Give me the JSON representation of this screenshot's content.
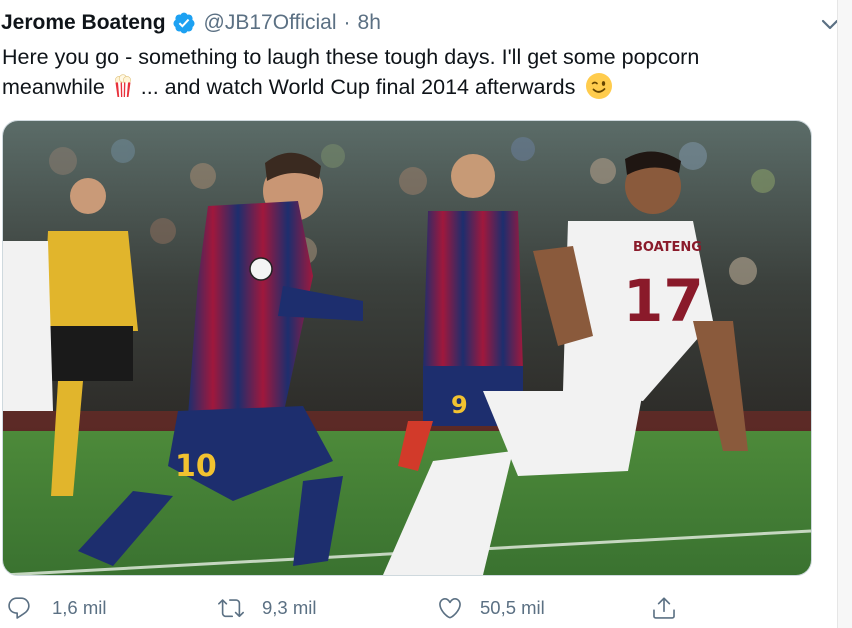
{
  "tweet": {
    "author": {
      "name": "Jerome Boateng",
      "handle": "@JB17Official",
      "separator": "·",
      "time": "8h",
      "verified": true
    },
    "text": {
      "line1": "Here you go - something to laugh these tough days. I'll get some popcorn",
      "line2_a": "meanwhile",
      "line2_b": " ... and watch World Cup final 2014 afterwards",
      "emoji_1": "popcorn-emoji",
      "emoji_2": "winking-face-emoji"
    },
    "media": {
      "description_icon": "photo",
      "player_1_number": "10",
      "player_2_number": "17",
      "player_2_name": "BOATENG",
      "player_3_number": "9"
    },
    "actions": {
      "replies": "1,6 mil",
      "retweets": "9,3 mil",
      "likes": "50,5 mil"
    }
  },
  "colors": {
    "accent": "#1da1f2",
    "muted": "#5b7083",
    "text": "#0f1419",
    "pitch": "#3e7a34"
  }
}
